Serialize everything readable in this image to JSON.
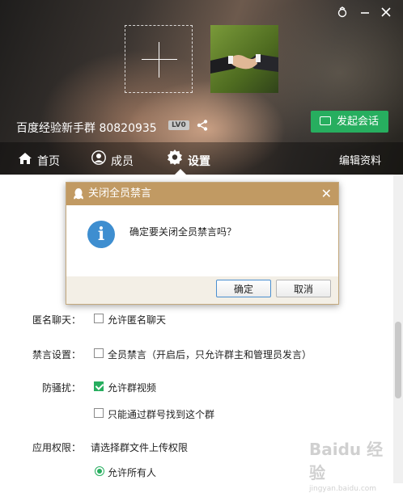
{
  "header": {
    "group_name": "百度经验新手群 80820935",
    "level_badge": "LV0",
    "chat_button": "发起会话",
    "tabs": [
      {
        "label": "首页",
        "icon": "home-icon"
      },
      {
        "label": "成员",
        "icon": "user-icon"
      },
      {
        "label": "设置",
        "icon": "gear-icon"
      }
    ],
    "edit_link": "编辑资料"
  },
  "settings": {
    "anonymous_label": "匿名聊天：",
    "anonymous_option": "允许匿名聊天",
    "anonymous_checked": false,
    "mute_label": "禁言设置：",
    "mute_option": "全员禁言（开启后，只允许群主和管理员发言）",
    "mute_checked": false,
    "anti_harass_label": "防骚扰：",
    "video_option": "允许群视频",
    "video_checked": true,
    "find_option": "只能通过群号找到这个群",
    "find_checked": false,
    "app_perm_label": "应用权限：",
    "app_perm_hint": "请选择群文件上传权限",
    "upload_option": "允许所有人"
  },
  "dialog": {
    "title": "关闭全员禁言",
    "message": "确定要关闭全员禁言吗？",
    "ok_label": "确定",
    "cancel_label": "取消"
  },
  "watermark": {
    "text": "Baidu 经验",
    "url": "jingyan.baidu.com"
  }
}
